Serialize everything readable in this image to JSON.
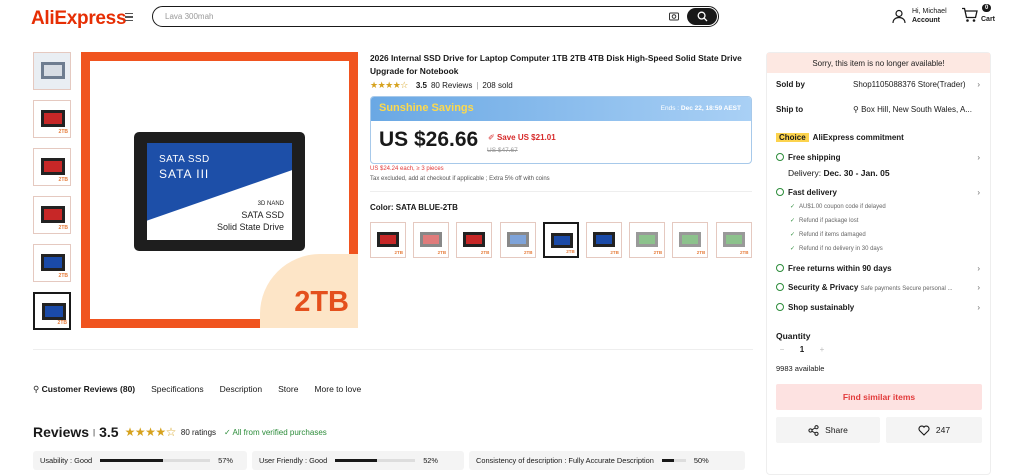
{
  "header": {
    "logo": "AliExpress",
    "search_placeholder": "Lava 300mah",
    "account_greeting": "Hi, Michael",
    "account_label": "Account",
    "cart_count": "0",
    "cart_label": "Cart"
  },
  "gallery": {
    "thumb_tag": "2TB",
    "ssd_line1": "SATA SSD",
    "ssd_line2": "SATA III",
    "ssd_line3": "3D NAND",
    "ssd_line4": "SATA SSD",
    "ssd_line5": "Solid State Drive",
    "badge": "2TB"
  },
  "product": {
    "title": "2026 Internal SSD Drive for Laptop Computer 1TB 2TB 4TB Disk High-Speed Solid State Drive Upgrade for Notebook",
    "rating": "3.5",
    "reviews": "80 Reviews",
    "sold": "208 sold",
    "promo_name": "Sunshine Savings",
    "promo_ends_label": "Ends :",
    "promo_ends_date": "Dec 22, 18:59 AEST",
    "price": "US $26.66",
    "save": "Save US $21.01",
    "original_price": "US $47.67",
    "bulk_price": "US $24.24 each, ≥ 3 pieces",
    "tax_note": "Tax excluded, add at checkout if applicable ; Extra 5% off with coins",
    "color_label": "Color: SATA BLUE-2TB",
    "swatch_tag": "2TB"
  },
  "tabs": [
    "Customer Reviews (80)",
    "Specifications",
    "Description",
    "Store",
    "More to love"
  ],
  "reviews": {
    "heading": "Reviews",
    "score": "3.5",
    "ratings": "80 ratings",
    "verified": "All from verified purchases",
    "metrics": [
      {
        "label": "Usability : Good",
        "pct": "57%",
        "value": 0.57
      },
      {
        "label": "User Friendly : Good",
        "pct": "52%",
        "value": 0.52
      },
      {
        "label": "Consistency of description : Fully Accurate Description",
        "pct": "50%",
        "value": 0.5
      }
    ]
  },
  "side": {
    "unavailable": "Sorry, this item is no longer available!",
    "sold_by_label": "Sold by",
    "sold_by_value": "Shop1105088376 Store(Trader)",
    "ship_to_label": "Ship to",
    "ship_to_value": "Box Hill, New South Wales, A...",
    "choice_badge": "Choice",
    "commitment": "AliExpress commitment",
    "free_shipping": "Free shipping",
    "delivery_label": "Delivery:",
    "delivery_dates": "Dec. 30 - Jan. 05",
    "fast_delivery": "Fast delivery",
    "fast_items": [
      "AU$1.00 coupon code if delayed",
      "Refund if package lost",
      "Refund if items damaged",
      "Refund if no delivery in 30 days"
    ],
    "free_returns": "Free returns within 90 days",
    "security": "Security & Privacy",
    "security_sub": "Safe payments Secure personal ...",
    "shop_sustainably": "Shop sustainably",
    "quantity_label": "Quantity",
    "quantity_minus": "−",
    "quantity_value": "1",
    "quantity_plus": "+",
    "available": "9983 available",
    "find_similar": "Find similar items",
    "share": "Share",
    "wishlist_count": "247"
  },
  "colors": {
    "brand": "#e62e04",
    "star": "#d6a21e",
    "choice_yellow": "#fcd34d",
    "promo_blue": "#6aa8e4",
    "price_red": "#d72b2b",
    "verified_green": "#2c8c3a"
  }
}
